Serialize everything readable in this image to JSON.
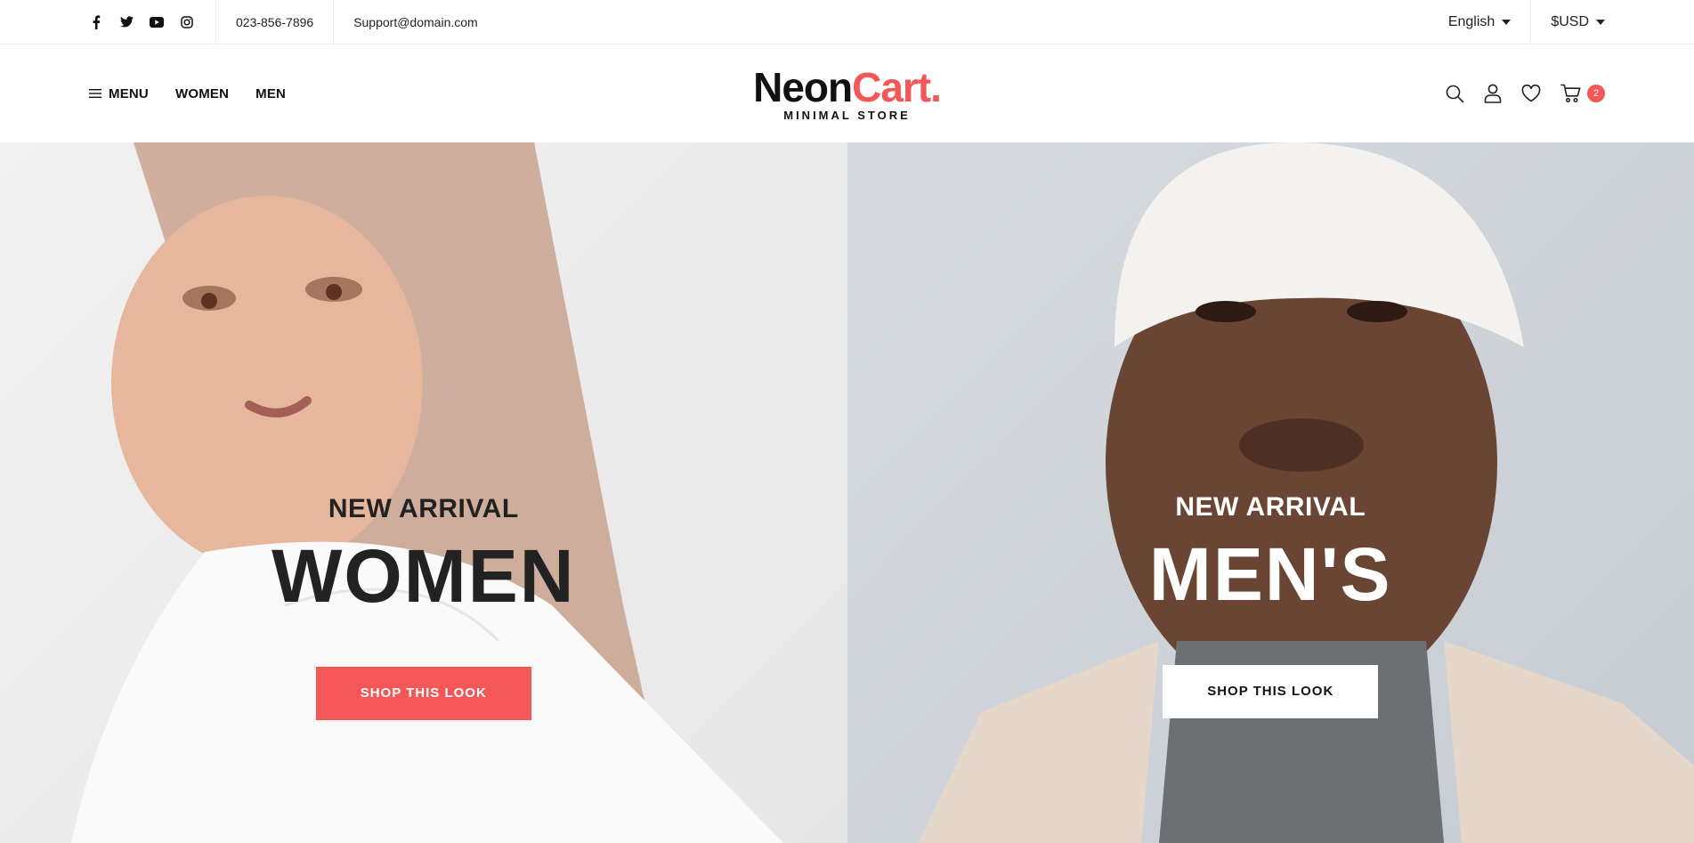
{
  "topbar": {
    "social_icons": [
      "facebook-icon",
      "twitter-icon",
      "youtube-icon",
      "instagram-icon"
    ],
    "phone": "023-856-7896",
    "email": "Support@domain.com",
    "language": "English",
    "currency": "$USD"
  },
  "header": {
    "menu_label": "MENU",
    "nav": [
      "WOMEN",
      "MEN"
    ],
    "logo": {
      "part1": "Neon",
      "part2": "Cart.",
      "tagline": "MINIMAL STORE"
    },
    "icons": [
      "search-icon",
      "user-icon",
      "heart-icon",
      "cart-icon"
    ],
    "cart_count": "2"
  },
  "hero": {
    "women": {
      "eyebrow": "NEW ARRIVAL",
      "title": "WOMEN",
      "cta": "SHOP THIS LOOK"
    },
    "men": {
      "eyebrow": "NEW ARRIVAL",
      "title": "MEN'S",
      "cta": "SHOP THIS LOOK"
    }
  },
  "colors": {
    "accent": "#f45757",
    "text": "#111111"
  }
}
